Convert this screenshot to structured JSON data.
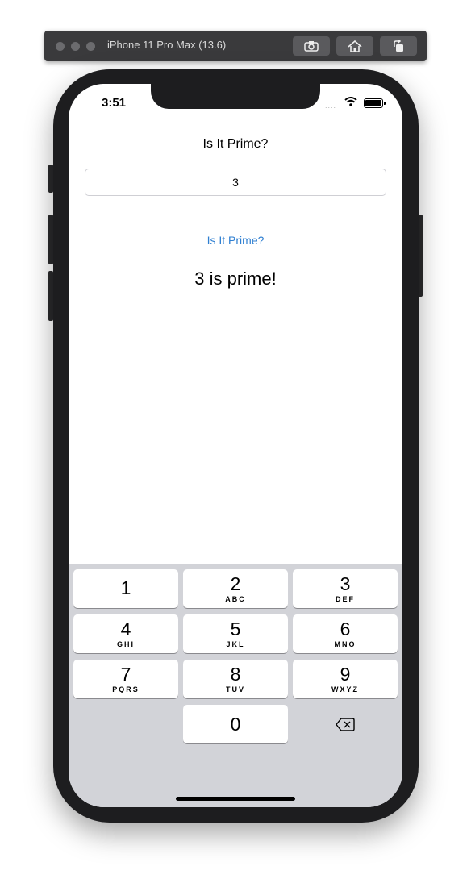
{
  "simulator": {
    "title": "iPhone 11 Pro Max (13.6)",
    "buttons": [
      {
        "icon": "screenshot-icon"
      },
      {
        "icon": "home-icon"
      },
      {
        "icon": "rotate-icon"
      }
    ]
  },
  "status_bar": {
    "time": "3:51",
    "signal": "....",
    "icons": [
      "wifi-icon",
      "battery-icon"
    ]
  },
  "app": {
    "title": "Is It Prime?",
    "number_value": "3",
    "check_button_label": "Is It Prime?",
    "result_text": "3 is prime!",
    "accent_color": "#2f7fd1"
  },
  "keypad": {
    "keys": [
      {
        "digit": "1",
        "letters": ""
      },
      {
        "digit": "2",
        "letters": "ABC"
      },
      {
        "digit": "3",
        "letters": "DEF"
      },
      {
        "digit": "4",
        "letters": "GHI"
      },
      {
        "digit": "5",
        "letters": "JKL"
      },
      {
        "digit": "6",
        "letters": "MNO"
      },
      {
        "digit": "7",
        "letters": "PQRS"
      },
      {
        "digit": "8",
        "letters": "TUV"
      },
      {
        "digit": "9",
        "letters": "WXYZ"
      },
      {
        "digit": "0",
        "letters": ""
      }
    ],
    "delete_icon": "backspace-icon"
  }
}
